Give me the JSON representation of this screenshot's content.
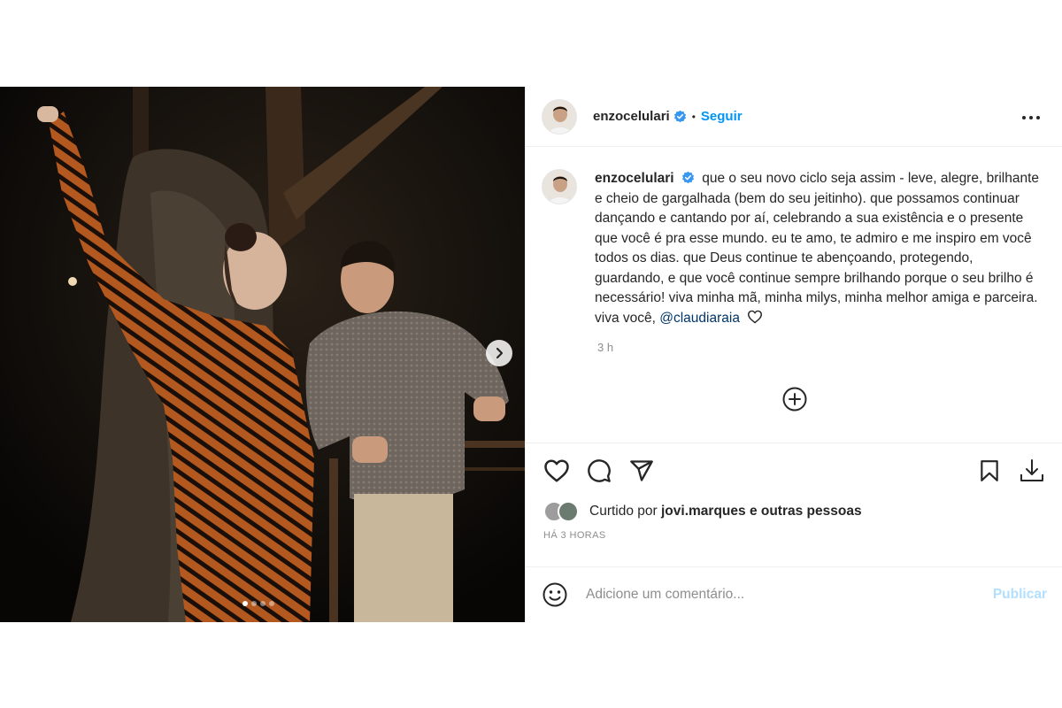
{
  "post": {
    "username": "enzocelulari",
    "separator": "•",
    "follow_label": "Seguir",
    "caption": {
      "username": "enzocelulari",
      "text": "que o seu novo ciclo seja assim - leve, alegre, brilhante e cheio de gargalhada (bem do seu jeitinho). que possamos continuar dançando e cantando por aí, celebrando a sua existência e o presente que você é pra esse mundo. eu te amo, te admiro e me inspiro em você todos os dias. que Deus continue te abençoando, protegendo, guardando, e que você continue sempre brilhando porque o seu brilho é necessário! viva minha mã, minha milys, minha melhor amiga e parceira. viva você,",
      "mention": "@claudiaraia",
      "time": "3 h"
    },
    "likes": {
      "prefix": "Curtido por",
      "user": "jovi.marques",
      "suffix": "e outras pessoas"
    },
    "timestamp": "HÁ 3 HORAS",
    "comment": {
      "placeholder": "Adicione um comentário...",
      "publish_label": "Publicar"
    },
    "carousel": {
      "current": 1,
      "total": 4
    }
  },
  "icons": {
    "verified": "verified-badge-icon",
    "more": "more-options-icon",
    "next": "chevron-right-icon",
    "load_more": "plus-circle-icon",
    "like": "heart-icon",
    "comment": "comment-icon",
    "share": "paper-plane-icon",
    "save": "bookmark-icon",
    "download": "download-icon",
    "emoji": "emoji-icon"
  },
  "colors": {
    "accent": "#0095f6",
    "publish_disabled": "#b2dffc",
    "mention": "#00376b",
    "muted": "#8e8e8e"
  }
}
